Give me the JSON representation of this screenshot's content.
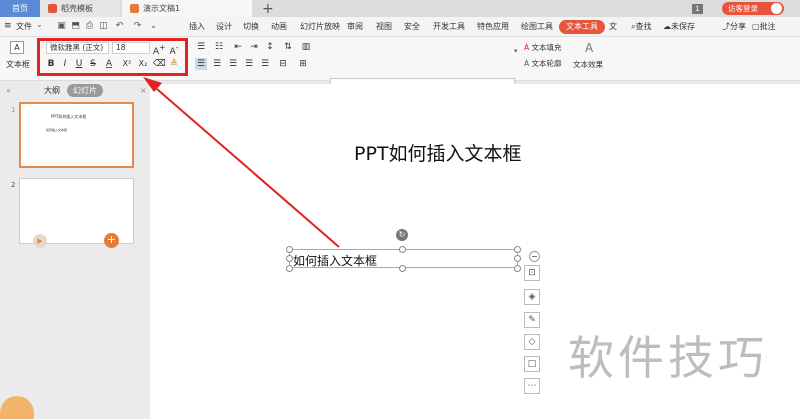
{
  "tabs": {
    "home": "首页",
    "template": "稻壳模板",
    "document": "演示文稿1",
    "add": "+"
  },
  "topbar": {
    "page_badge": "1",
    "login": "访客登录"
  },
  "menu": {
    "file": "文件",
    "items": [
      "插入",
      "设计",
      "切换",
      "动画",
      "幻灯片放映",
      "审阅",
      "视图",
      "安全",
      "开发工具",
      "特色应用",
      "绘图工具"
    ],
    "text_tool": "文本工具",
    "more": "文",
    "search": "查找",
    "unsaved": "未保存",
    "share": "分享",
    "comment": "批注"
  },
  "ribbon": {
    "textbox": "文本框",
    "font_name": "微软雅黑 (正文)",
    "font_size": "18",
    "bold": "B",
    "italic": "I",
    "underline": "U",
    "strike": "S",
    "font_color": "A",
    "superscript": "X²",
    "subscript": "X₂",
    "wordart_letter": "A",
    "text_fill": "文本填充",
    "text_outline": "文本轮廓",
    "text_effect": "文本效果"
  },
  "panel": {
    "outline_tab": "大纲",
    "slides_tab": "幻灯片",
    "slide1_num": "1",
    "slide1_title": "PPT如何插入文本框",
    "slide1_body": "如何插入文本框",
    "slide2_num": "2"
  },
  "slide": {
    "title": "PPT如何插入文本框",
    "textbox_text": "如何插入文本框"
  },
  "watermark": "软件技巧",
  "colors": {
    "accent": "#e4553b",
    "highlight": "#e02222",
    "home_tab": "#5b8bd6"
  }
}
